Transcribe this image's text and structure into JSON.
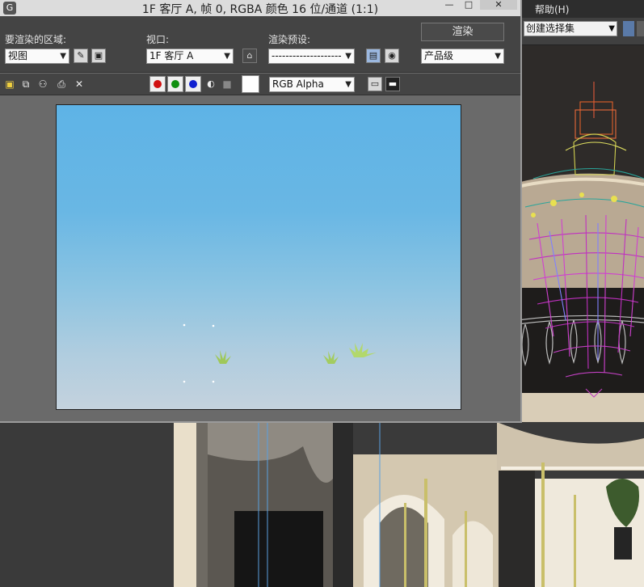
{
  "main_app": {
    "menu_help": "帮助(H)",
    "selection_set": "创建选择集"
  },
  "render_window": {
    "title": "1F 客厅 A, 帧 0, RGBA 颜色 16 位/通道 (1:1)",
    "region_label": "要渲染的区域:",
    "region_value": "视图",
    "viewport_label": "视口:",
    "viewport_value": "1F 客厅 A",
    "preset_label": "渲染预设:",
    "preset_value": "--------------------",
    "render_button": "渲染",
    "quality_value": "产品级",
    "channel_display": "RGB Alpha"
  },
  "colors": {
    "red_channel": "#d01010",
    "green_channel": "#109010",
    "blue_channel": "#1020d0",
    "render_bg": "#6a6a6a"
  }
}
